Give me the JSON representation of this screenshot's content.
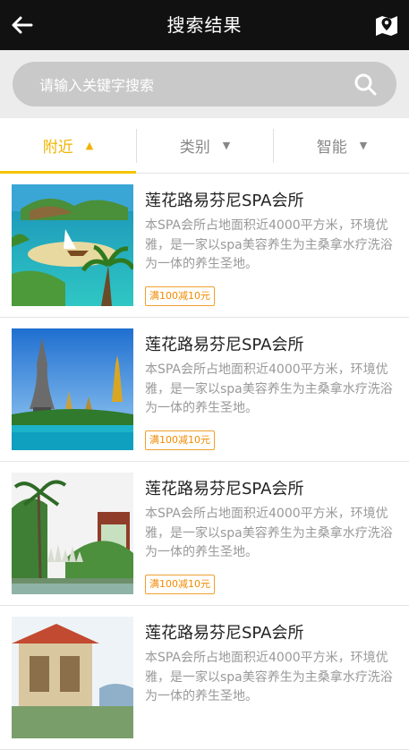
{
  "header": {
    "title": "搜索结果",
    "back_icon": "back-arrow-icon",
    "map_icon": "map-pin-icon"
  },
  "search": {
    "placeholder": "请输入关键字搜索",
    "icon": "search-icon"
  },
  "filters": [
    {
      "label": "附近",
      "active": true
    },
    {
      "label": "类别",
      "active": false
    },
    {
      "label": "智能",
      "active": false
    }
  ],
  "colors": {
    "accent": "#f5c400",
    "promo": "#f08a00",
    "header_bg": "#111111"
  },
  "results": [
    {
      "title": "莲花路易芬尼SPA会所",
      "description": "本SPA会所占地面积近4000平方米，环境优雅，是一家以spa美容养生为主桑拿水疗洗浴为一体的养生圣地。",
      "promo": "满100减10元"
    },
    {
      "title": "莲花路易芬尼SPA会所",
      "description": "本SPA会所占地面积近4000平方米，环境优雅，是一家以spa美容养生为主桑拿水疗洗浴为一体的养生圣地。",
      "promo": "满100减10元"
    },
    {
      "title": "莲花路易芬尼SPA会所",
      "description": "本SPA会所占地面积近4000平方米，环境优雅，是一家以spa美容养生为主桑拿水疗洗浴为一体的养生圣地。",
      "promo": "满100减10元"
    },
    {
      "title": "莲花路易芬尼SPA会所",
      "description": "本SPA会所占地面积近4000平方米，环境优雅，是一家以spa美容养生为主桑拿水疗洗浴为一体的养生圣地。",
      "promo": ""
    }
  ]
}
